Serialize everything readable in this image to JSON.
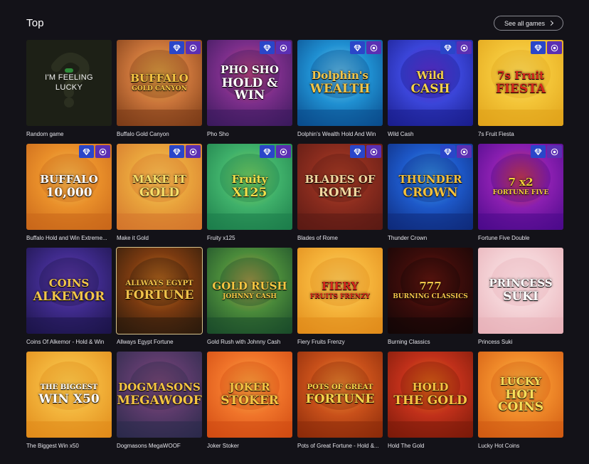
{
  "section": {
    "title": "Top",
    "see_all_label": "See all games"
  },
  "random_card": {
    "label_line1": "I'M FEELING",
    "label_line2": "LUCKY",
    "name": "Random game"
  },
  "games": [
    {
      "name": "Buffalo Gold Canyon",
      "logo_line1": "BUFFALO",
      "logo_line2": "GOLD CANYON",
      "colors": [
        "#7a3b17",
        "#c9743a",
        "#e9b24a"
      ],
      "text_color": "#f5c542",
      "badges": true
    },
    {
      "name": "Pho Sho",
      "logo_line1": "PHO SHO",
      "logo_line2": "HOLD & WIN",
      "colors": [
        "#3a1a5c",
        "#7b2e8a",
        "#d24a7a"
      ],
      "text_color": "#ffffff",
      "badges": true
    },
    {
      "name": "Dolphin's Wealth Hold And Win",
      "logo_line1": "Dolphin's",
      "logo_line2": "WEALTH",
      "colors": [
        "#0a4a8a",
        "#1f8fd1",
        "#7fd3f0"
      ],
      "text_color": "#f3c64a",
      "badges": true
    },
    {
      "name": "Wild Cash",
      "logo_line1": "Wild",
      "logo_line2": "CASH",
      "colors": [
        "#1a1e8c",
        "#3a45d8",
        "#6f2fd0"
      ],
      "text_color": "#f7d24b",
      "badges": true
    },
    {
      "name": "7s Fruit Fiesta",
      "logo_line1": "7s Fruit",
      "logo_line2": "FIESTA",
      "colors": [
        "#e0a21a",
        "#f3c437",
        "#f7df6a"
      ],
      "text_color": "#d6281c",
      "badges": true
    },
    {
      "name": "Buffalo Hold and Win Extreme...",
      "logo_line1": "BUFFALO",
      "logo_line2": "10,000",
      "colors": [
        "#c8661a",
        "#e98f2a",
        "#f5c55a"
      ],
      "text_color": "#ffffff",
      "badges": true
    },
    {
      "name": "Make it Gold",
      "logo_line1": "MAKE IT",
      "logo_line2": "GOLD",
      "colors": [
        "#d3742c",
        "#e9a33c",
        "#f6cf5c"
      ],
      "text_color": "#f8e06a",
      "badges": true
    },
    {
      "name": "Fruity x125",
      "logo_line1": "Fruity",
      "logo_line2": "X125",
      "colors": [
        "#1c7c4a",
        "#3fb06a",
        "#8ad860"
      ],
      "text_color": "#f3e04a",
      "badges": true
    },
    {
      "name": "Blades of Rome",
      "logo_line1": "BLADES OF",
      "logo_line2": "ROME",
      "colors": [
        "#5a1a14",
        "#8a2c1e",
        "#b94428"
      ],
      "text_color": "#f2d8a0",
      "badges": true
    },
    {
      "name": "Thunder Crown",
      "logo_line1": "THUNDER",
      "logo_line2": "CROWN",
      "colors": [
        "#0e2a7a",
        "#1d58c8",
        "#3fa3ef"
      ],
      "text_color": "#f4c13c",
      "badges": true
    },
    {
      "name": "Fortune Five Double",
      "logo_line1": "7 x2",
      "logo_line2": "FORTUNE FIVE",
      "colors": [
        "#4a0a8a",
        "#8a1fb0",
        "#e0472a"
      ],
      "text_color": "#f5d03a",
      "badges": true
    },
    {
      "name": "Coins Of Alkemor - Hold & Win",
      "logo_line1": "COINS",
      "logo_line2": "ALKEMOR",
      "colors": [
        "#1c1448",
        "#3e2a8a",
        "#6a3fb8"
      ],
      "text_color": "#f3c64a",
      "badges": false
    },
    {
      "name": "Allways Egypt Fortune",
      "logo_line1": "ALLWAYS EGYPT",
      "logo_line2": "FORTUNE",
      "colors": [
        "#2a1a0c",
        "#7a3a10",
        "#d97a22"
      ],
      "text_color": "#f0c24a",
      "badges": false,
      "highlight": true
    },
    {
      "name": "Gold Rush with Johnny Cash",
      "logo_line1": "GOLD RUSH",
      "logo_line2": "JOHNNY CASH",
      "colors": [
        "#1a4a2a",
        "#4a8a3a",
        "#c7a048"
      ],
      "text_color": "#f5c542",
      "badges": false
    },
    {
      "name": "Fiery Fruits Frenzy",
      "logo_line1": "FIERY",
      "logo_line2": "FRUITS FRENZY",
      "colors": [
        "#e08a1a",
        "#f5b33a",
        "#f7d46a"
      ],
      "text_color": "#d8261c",
      "badges": false
    },
    {
      "name": "Burning Classics",
      "logo_line1": "777",
      "logo_line2": "BURNING CLASSICS",
      "colors": [
        "#120606",
        "#3a0c0a",
        "#7a1a12"
      ],
      "text_color": "#f3c64a",
      "badges": false
    },
    {
      "name": "Princess Suki",
      "logo_line1": "PRINCESS",
      "logo_line2": "SUKI",
      "colors": [
        "#e8b0b8",
        "#f4d2d6",
        "#f9e6e8"
      ],
      "text_color": "#ffffff",
      "badges": false
    },
    {
      "name": "The Biggest Win x50",
      "logo_line1": "THE BIGGEST",
      "logo_line2": "WIN X50",
      "colors": [
        "#e08a1a",
        "#f2b23a",
        "#f7d45a"
      ],
      "text_color": "#ffffff",
      "badges": false
    },
    {
      "name": "Dogmasons MegaWOOF",
      "logo_line1": "DOGMASONS",
      "logo_line2": "MEGAWOOF",
      "colors": [
        "#2a2a4a",
        "#5a3a6a",
        "#8a4a7a"
      ],
      "text_color": "#f5c542",
      "badges": false
    },
    {
      "name": "Joker Stoker",
      "logo_line1": "JOKER",
      "logo_line2": "STOKER",
      "colors": [
        "#d04a12",
        "#f0742a",
        "#f8b34a"
      ],
      "text_color": "#f5c542",
      "badges": false
    },
    {
      "name": "Pots of Great Fortune - Hold &...",
      "logo_line1": "POTS OF GREAT",
      "logo_line2": "FORTUNE",
      "colors": [
        "#8a2a0a",
        "#c8501a",
        "#f2983a"
      ],
      "text_color": "#f5d44a",
      "badges": false
    },
    {
      "name": "Hold The Gold",
      "logo_line1": "HOLD",
      "logo_line2": "THE GOLD",
      "colors": [
        "#7a1a0a",
        "#c0301a",
        "#e8761a"
      ],
      "text_color": "#f5c542",
      "badges": false
    },
    {
      "name": "Lucky Hot Coins",
      "logo_line1": "LUCKY",
      "logo_line2": "HOT COINS",
      "colors": [
        "#d05a12",
        "#f08a2a",
        "#f8c24a"
      ],
      "text_color": "#f7df5a",
      "badges": false
    }
  ],
  "icons": {
    "gem": "diamond-icon",
    "drop": "drops-icon"
  }
}
